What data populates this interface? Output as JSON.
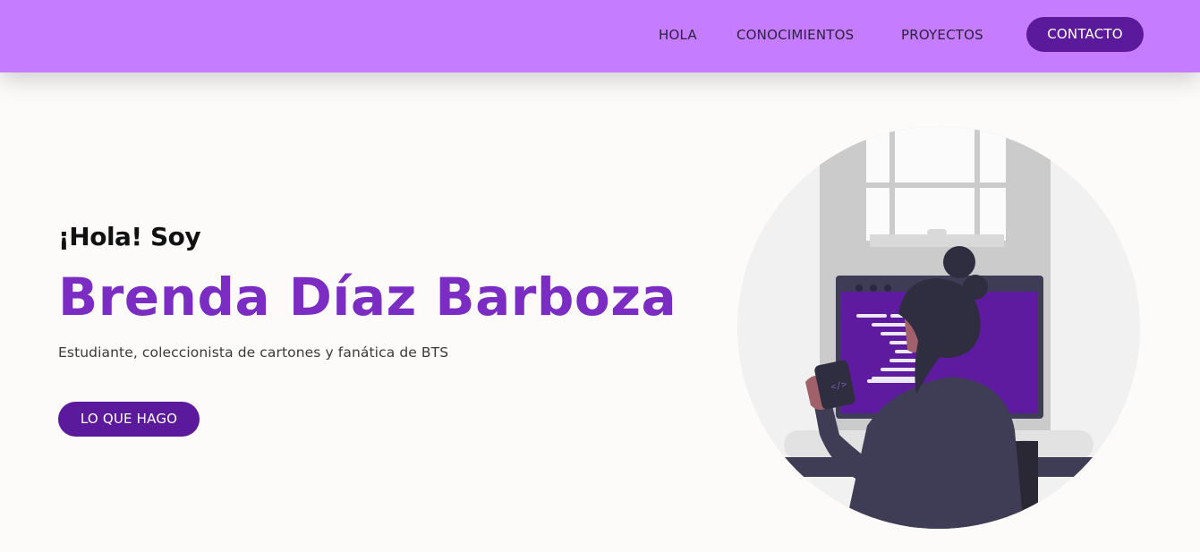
{
  "nav": {
    "items": [
      {
        "label": "HOLA"
      },
      {
        "label": "CONOCIMIENTOS"
      },
      {
        "label": "PROYECTOS"
      }
    ],
    "contact_label": "CONTACTO"
  },
  "hero": {
    "greeting": "¡Hola! Soy",
    "name": "Brenda Díaz Barboza",
    "tagline": "Estudiante, coleccionista de cartones y fanática de BTS",
    "cta_label": "LO QUE HAGO"
  },
  "illustration": {
    "icon": "developer-at-desk-illustration",
    "code_symbol": "</>"
  },
  "colors": {
    "navbar": "#c57cff",
    "accent": "#5b1a9b",
    "name": "#7b2cc2",
    "background": "#fcfbfa"
  }
}
